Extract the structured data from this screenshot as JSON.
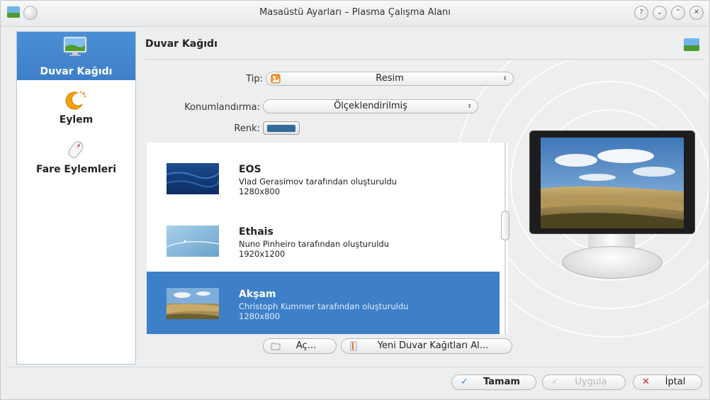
{
  "window": {
    "title": "Masaüstü Ayarları – Plasma Çalışma Alanı",
    "controls": [
      "?",
      "⌄",
      "⌃",
      "✕"
    ]
  },
  "sidebar": {
    "items": [
      {
        "label": "Duvar Kağıdı",
        "icon": "wallpaper-icon",
        "active": true
      },
      {
        "label": "Eylem",
        "icon": "activity-icon",
        "active": false
      },
      {
        "label": "Fare Eylemleri",
        "icon": "mouse-icon",
        "active": false
      }
    ]
  },
  "header": {
    "title": "Duvar Kağıdı"
  },
  "form": {
    "type_label": "Tip:",
    "type_value": "Resim",
    "position_label": "Konumlandırma:",
    "position_value": "Ölçeklendirilmiş",
    "color_label": "Renk:",
    "color_value": "#336a97"
  },
  "wallpapers": [
    {
      "name": "EOS",
      "author": "Vlad Gerasimov tarafından oluşturuldu",
      "resolution": "1280x800",
      "selected": false
    },
    {
      "name": "Ethais",
      "author": "Nuno Pinheiro tarafından oluşturuldu",
      "resolution": "1920x1200",
      "selected": false
    },
    {
      "name": "Akşam",
      "author": "Christoph Kummer tarafından oluşturuldu",
      "resolution": "1280x800",
      "selected": true
    }
  ],
  "list_buttons": {
    "open_label": "Aç...",
    "get_new_label": "Yeni Duvar Kağıtları Al..."
  },
  "dialog_buttons": {
    "ok_label": "Tamam",
    "apply_label": "Uygula",
    "cancel_label": "İptal"
  },
  "colors": {
    "accent": "#3d7fc8",
    "selection_text": "#ffffff"
  }
}
